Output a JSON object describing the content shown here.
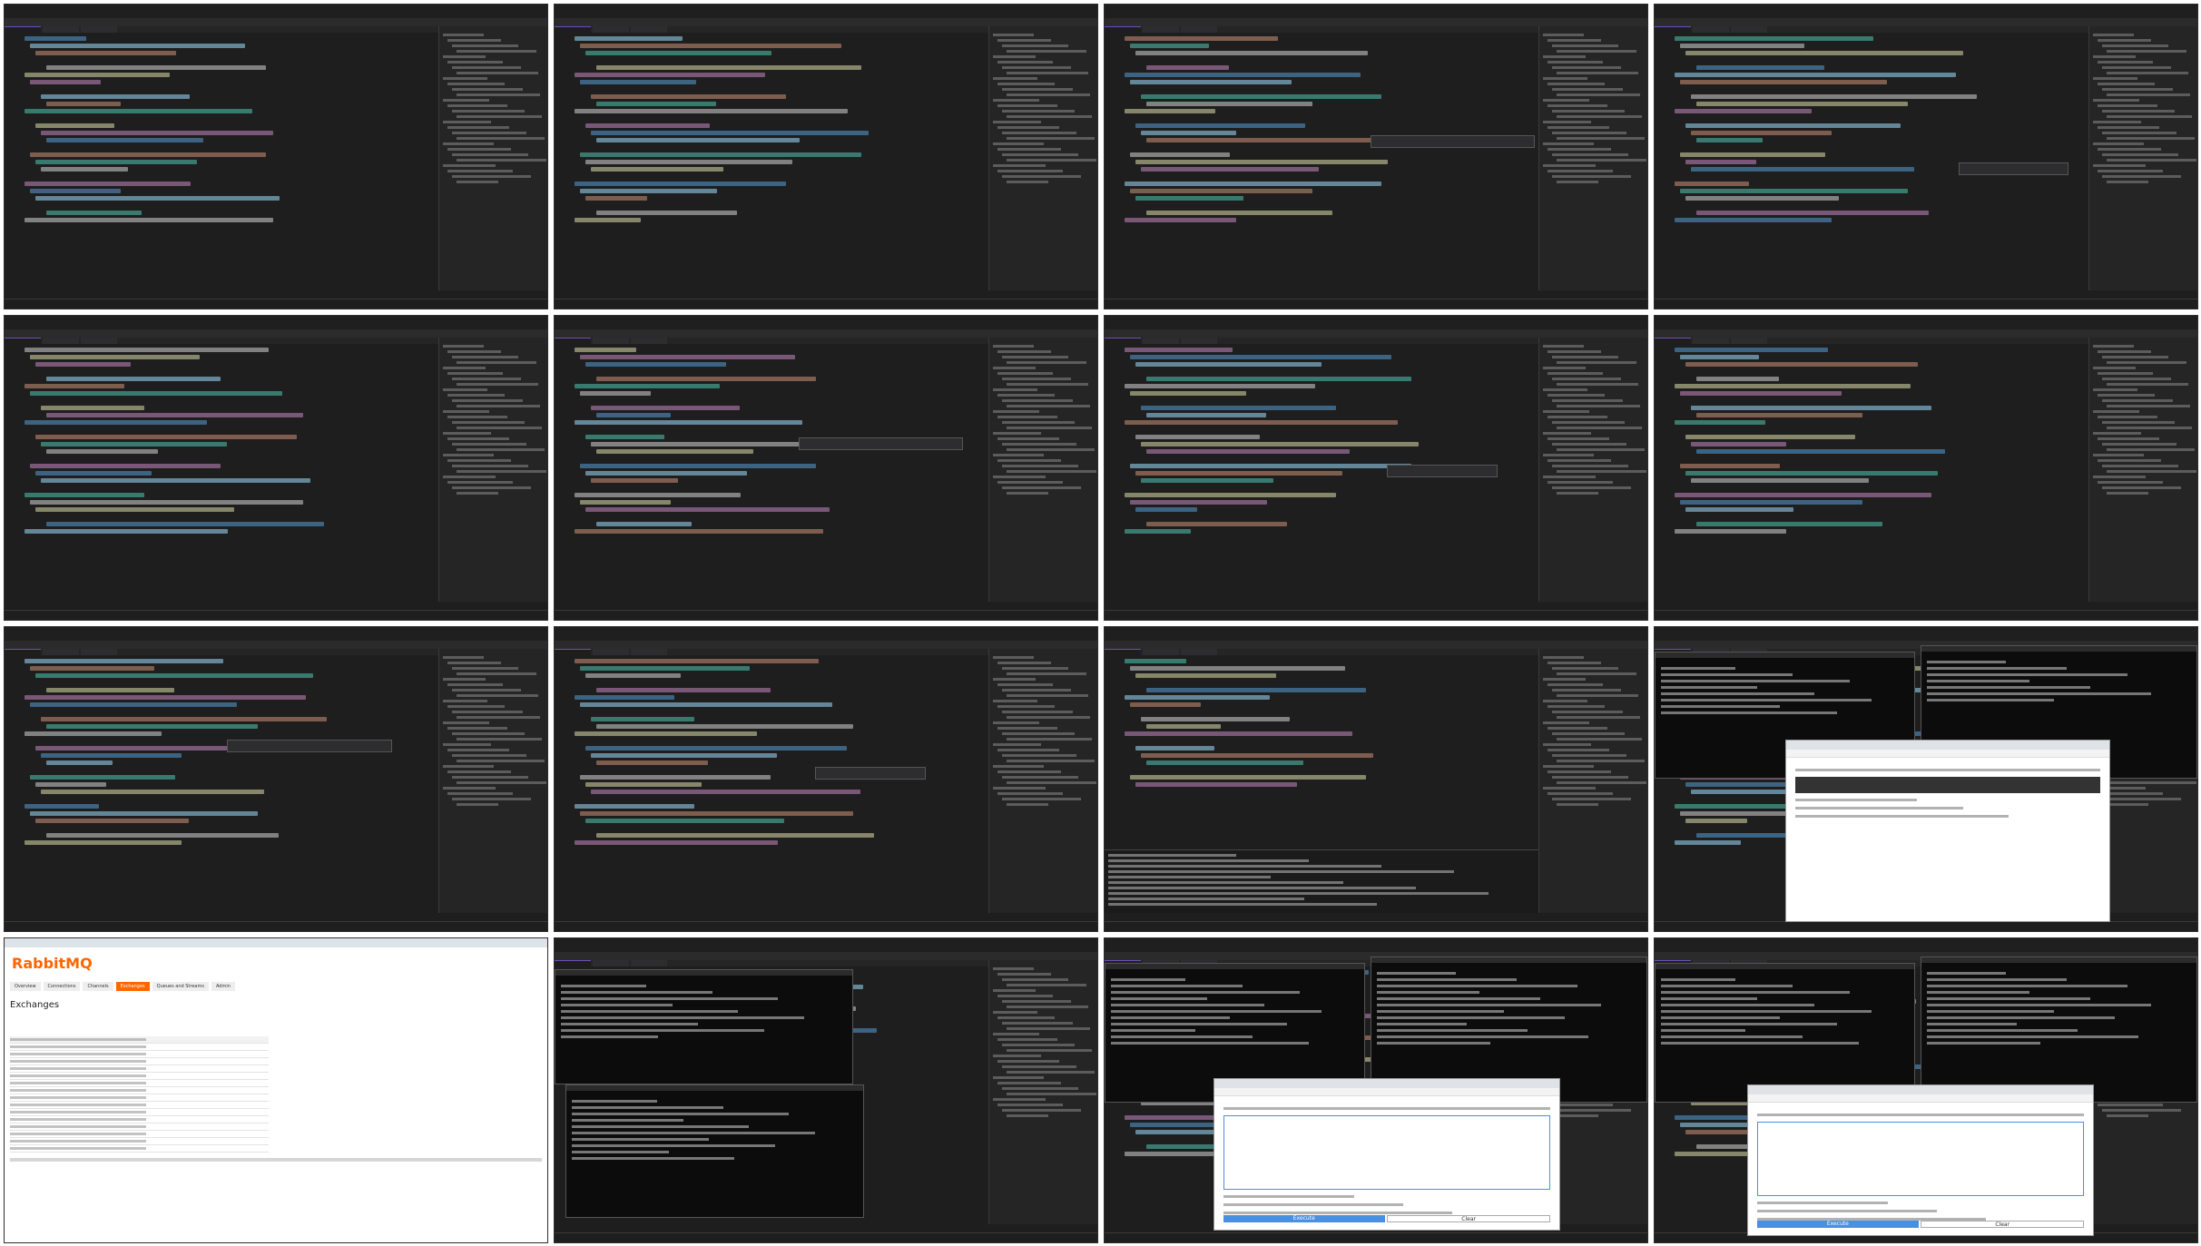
{
  "frames": [
    {
      "kind": "vs",
      "tooltip": false
    },
    {
      "kind": "vs",
      "tooltip": false
    },
    {
      "kind": "vs",
      "tooltip": true
    },
    {
      "kind": "vs",
      "tooltip": true
    },
    {
      "kind": "vs",
      "tooltip": false
    },
    {
      "kind": "vs",
      "tooltip": true
    },
    {
      "kind": "vs",
      "tooltip": true
    },
    {
      "kind": "vs",
      "tooltip": false
    },
    {
      "kind": "vs",
      "tooltip": true
    },
    {
      "kind": "vs",
      "tooltip": true
    },
    {
      "kind": "vs-output",
      "tooltip": false
    },
    {
      "kind": "console-browser",
      "tooltip": false
    },
    {
      "kind": "rabbitmq",
      "tooltip": false
    },
    {
      "kind": "vs-consoles",
      "tooltip": false
    },
    {
      "kind": "console-browser-exec",
      "tooltip": false
    },
    {
      "kind": "console-browser-exec",
      "tooltip": false
    }
  ],
  "rabbitmq": {
    "logo_main": "RabbitMQ",
    "nav": [
      "Overview",
      "Connections",
      "Channels",
      "Exchanges",
      "Queues and Streams",
      "Admin"
    ],
    "heading": "Exchanges"
  },
  "browser": {
    "execute_label": "Execute",
    "clear_label": "Clear"
  }
}
